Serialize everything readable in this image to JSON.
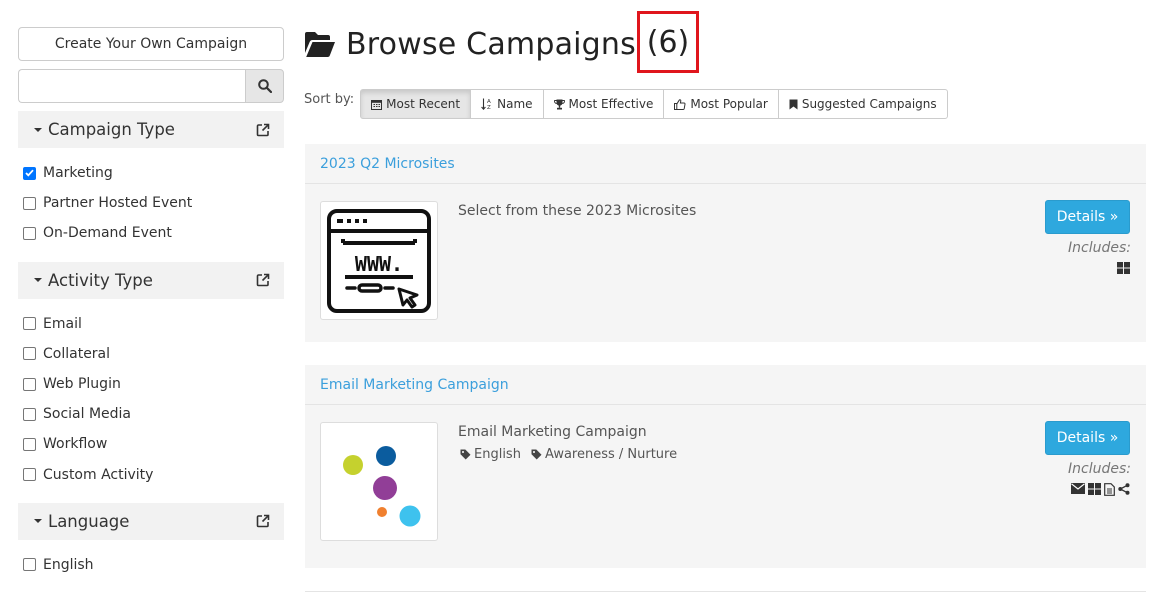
{
  "sidebar": {
    "create_label": "Create Your Own Campaign",
    "search_placeholder": "",
    "filters": [
      {
        "title": "Campaign Type",
        "items": [
          {
            "label": "Marketing",
            "checked": true
          },
          {
            "label": "Partner Hosted Event",
            "checked": false
          },
          {
            "label": "On-Demand Event",
            "checked": false
          }
        ]
      },
      {
        "title": "Activity Type",
        "items": [
          {
            "label": "Email",
            "checked": false
          },
          {
            "label": "Collateral",
            "checked": false
          },
          {
            "label": "Web Plugin",
            "checked": false
          },
          {
            "label": "Social Media",
            "checked": false
          },
          {
            "label": "Workflow",
            "checked": false
          },
          {
            "label": "Custom Activity",
            "checked": false
          }
        ]
      },
      {
        "title": "Language",
        "items": [
          {
            "label": "English",
            "checked": false
          }
        ]
      }
    ]
  },
  "main": {
    "title": "Browse Campaigns",
    "count": "(6)",
    "sort_label": "Sort by:",
    "sort_options": [
      "Most Recent",
      "Name",
      "Most Effective",
      "Most Popular",
      "Suggested Campaigns"
    ],
    "details_label": "Details »",
    "includes_label": "Includes:",
    "cards": [
      {
        "title": "2023 Q2 Microsites",
        "description": "Select from these 2023 Microsites",
        "tags": []
      },
      {
        "title": "Email Marketing Campaign",
        "description": "Email Marketing Campaign",
        "tags": [
          "English",
          "Awareness / Nurture"
        ]
      }
    ]
  },
  "colors": {
    "link": "#3b9fdc",
    "details_button": "#2ea8de",
    "highlight_box": "#e0161d",
    "checkbox_checked": "#0075ff",
    "dot_lime": "#c5d12e",
    "dot_navy": "#0b5c9e",
    "dot_purple": "#913e97",
    "dot_orange": "#f0802f",
    "dot_sky": "#3ec2ee"
  }
}
